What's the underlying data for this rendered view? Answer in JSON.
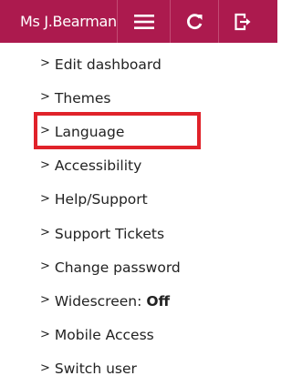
{
  "header": {
    "username": "Ms J.Bearman",
    "buttons": [
      {
        "icon": "hamburger-menu-icon"
      },
      {
        "icon": "refresh-icon"
      },
      {
        "icon": "logout-icon"
      }
    ]
  },
  "menu": {
    "chevron": ">",
    "items": [
      {
        "label": "Edit dashboard"
      },
      {
        "label": "Themes"
      },
      {
        "label": "Language"
      },
      {
        "label": "Accessibility"
      },
      {
        "label": "Help/Support"
      },
      {
        "label": "Support Tickets"
      },
      {
        "label": "Change password"
      },
      {
        "label": "Widescreen:",
        "value": "Off"
      },
      {
        "label": "Mobile Access"
      },
      {
        "label": "Switch user"
      }
    ]
  },
  "colors": {
    "header_bg": "#ac1a4e",
    "highlight_border": "#e0222a",
    "text": "#222222"
  }
}
